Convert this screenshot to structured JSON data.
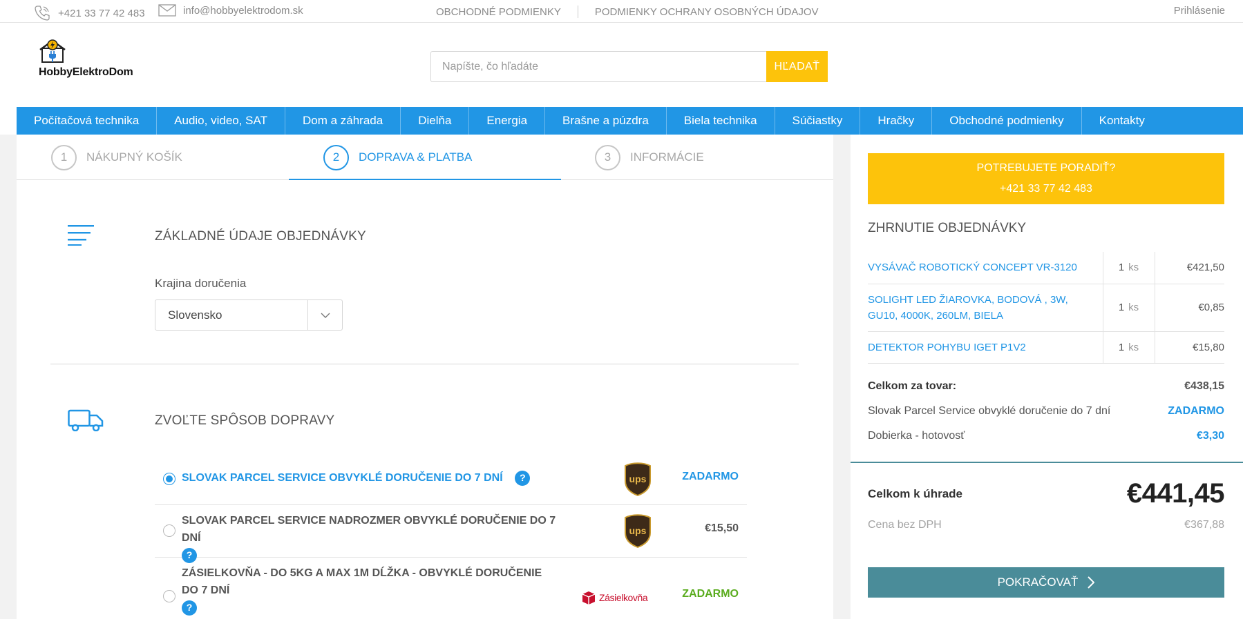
{
  "topbar": {
    "phone": "+421 33 77 42 483",
    "email": "info@hobbyelektrodom.sk",
    "link_terms": "OBCHODNÉ PODMIENKY",
    "link_privacy": "PODMIENKY OCHRANY OSOBNÝCH ÚDAJOV",
    "login": "Prihlásenie"
  },
  "logo": {
    "brand": "HobbyElektroDom"
  },
  "search": {
    "placeholder": "Napíšte, čo hľadáte",
    "button": "HĽADAŤ"
  },
  "nav": {
    "items": [
      "Počítačová technika",
      "Audio, video, SAT",
      "Dom a záhrada",
      "Dielňa",
      "Energia",
      "Brašne a púzdra",
      "Biela technika",
      "Súčiastky",
      "Hračky",
      "Obchodné podmienky",
      "Kontakty"
    ]
  },
  "steps": [
    {
      "num": "1",
      "label": "NÁKUPNÝ KOŠÍK"
    },
    {
      "num": "2",
      "label": "DOPRAVA & PLATBA"
    },
    {
      "num": "3",
      "label": "INFORMÁCIE"
    }
  ],
  "order_basics": {
    "title": "ZÁKLADNÉ ÚDAJE OBJEDNÁVKY",
    "country_label": "Krajina doručenia",
    "country_value": "Slovensko"
  },
  "shipping": {
    "title": "ZVOĽTE SPÔSOB DOPRAVY",
    "options": [
      {
        "name": "SLOVAK PARCEL SERVICE OBVYKLÉ DORUČENIE DO 7 DNÍ",
        "price": "ZADARMO",
        "selected": true
      },
      {
        "name": "SLOVAK PARCEL SERVICE NADROZMER OBVYKLÉ DORUČENIE DO 7 DNÍ",
        "price": "€15,50",
        "selected": false
      },
      {
        "name": "ZÁSIELKOVŇA - DO 5KG A MAX 1M DĹŽKA - OBVYKLÉ DORUČENIE DO 7 DNÍ",
        "price": "ZADARMO",
        "selected": false
      }
    ],
    "help": "?",
    "ups_text": "ups",
    "zasielkovna_text": "Zásielkovňa"
  },
  "sidebar": {
    "help_line1": "POTREBUJETE PORADIŤ?",
    "help_line2": "+421 33 77 42 483",
    "summary_title": "ZHRNUTIE OBJEDNÁVKY",
    "items": [
      {
        "name": "VYSÁVAČ ROBOTICKÝ CONCEPT VR-3120",
        "qty": "1",
        "unit": "ks",
        "price": "€421,50"
      },
      {
        "name": "SOLIGHT LED ŽIAROVKA, BODOVÁ , 3W, GU10, 4000K, 260LM, BIELA",
        "qty": "1",
        "unit": "ks",
        "price": "€0,85"
      },
      {
        "name": "DETEKTOR POHYBU IGET P1V2",
        "qty": "1",
        "unit": "ks",
        "price": "€15,80"
      }
    ],
    "goods_total_label": "Celkom za tovar:",
    "goods_total_value": "€438,15",
    "shipping_label": "Slovak Parcel Service obvyklé doručenie do 7 dní",
    "shipping_value": "ZADARMO",
    "payment_label": "Dobierka - hotovosť",
    "payment_value": "€3,30",
    "grand_label": "Celkom k úhrade",
    "grand_value": "€441,45",
    "novat_label": "Cena bez DPH",
    "novat_value": "€367,88",
    "continue": "POKRAČOVAŤ"
  },
  "colors": {
    "accent": "#2196e5",
    "yellow": "#fdc30b",
    "teal": "#4a8c99",
    "green": "#5aac1e"
  }
}
